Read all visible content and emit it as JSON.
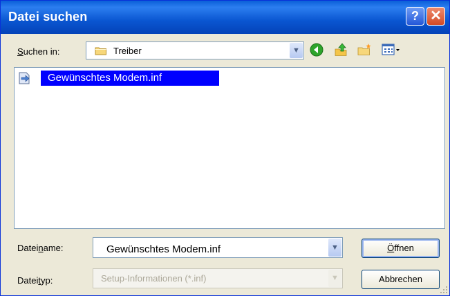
{
  "window": {
    "title": "Datei suchen",
    "help_glyph": "?",
    "close_glyph": "✕"
  },
  "look_in": {
    "label_u": "S",
    "label_rest": "uchen in:",
    "value": "Treiber",
    "folder_icon": "folder-icon"
  },
  "toolbar": {
    "icons": [
      "back-icon",
      "up-folder-icon",
      "new-folder-icon",
      "view-menu-icon"
    ]
  },
  "file_list": {
    "items": [
      {
        "name": "Gewünschtes Modem.inf",
        "icon": "setup-information-file-icon",
        "selected": true
      }
    ]
  },
  "filename": {
    "label_pre": "Datei",
    "label_u": "n",
    "label_post": "ame:",
    "value": "Gewünschtes Modem.inf"
  },
  "filetype": {
    "label_pre": "Datei",
    "label_u": "t",
    "label_post": "yp:",
    "value": "Setup-Informationen (*.inf)",
    "disabled": true
  },
  "buttons": {
    "open_u": "Ö",
    "open_rest": "ffnen",
    "cancel": "Abbrechen"
  },
  "colors": {
    "titlebar": "#0a56d1",
    "selection": "#0000ff",
    "dialog_bg": "#ece9d8"
  }
}
